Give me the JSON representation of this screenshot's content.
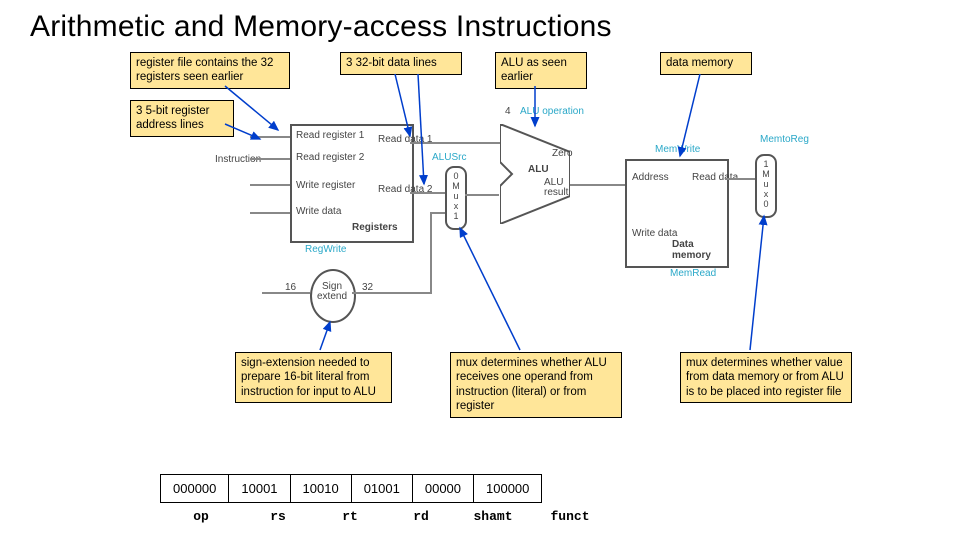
{
  "title": "Arithmetic and Memory-access Instructions",
  "callouts": {
    "regfile": "register file contains the 32 registers seen earlier",
    "datalines": "3 32-bit data lines",
    "alu": "ALU as seen earlier",
    "dmem": "data memory",
    "addrlines": "3 5-bit register address lines",
    "signext": "sign-extension needed to prepare 16-bit literal from instruction for input to ALU",
    "mux1": "mux determines whether ALU receives one operand from instruction (literal) or from register",
    "mux2": "mux determines whether value from data memory or from ALU is to be placed into register file"
  },
  "diagram": {
    "instr": "Instruction",
    "reg_rd1": "Read register 1",
    "reg_rd2": "Read register 2",
    "reg_wr": "Write register",
    "reg_wd": "Write data",
    "reg_title": "Registers",
    "rdata1": "Read data 1",
    "rdata2": "Read data 2",
    "regwrite": "RegWrite",
    "alusrc": "ALUSrc",
    "aluop": "ALU operation",
    "alu_lbl": "ALU",
    "zero": "Zero",
    "alures": "ALU result",
    "signext": "Sign extend",
    "bits16": "16",
    "bits32": "32",
    "alu4": "4",
    "mux_a": "0 M u x 1",
    "mux_b": "1 M u x 0",
    "memwrite": "MemWrite",
    "memread": "MemRead",
    "mem2reg": "MemtoReg",
    "dmem_title": "Data memory",
    "addr": "Address",
    "wrdata": "Write data",
    "rddata": "Read data"
  },
  "encoding": {
    "fields": [
      "000000",
      "10001",
      "10010",
      "01001",
      "00000",
      "100000"
    ],
    "labels": [
      "op",
      "rs",
      "rt",
      "rd",
      "shamt",
      "funct"
    ],
    "widths": [
      80,
      72,
      72,
      72,
      72,
      80
    ]
  }
}
